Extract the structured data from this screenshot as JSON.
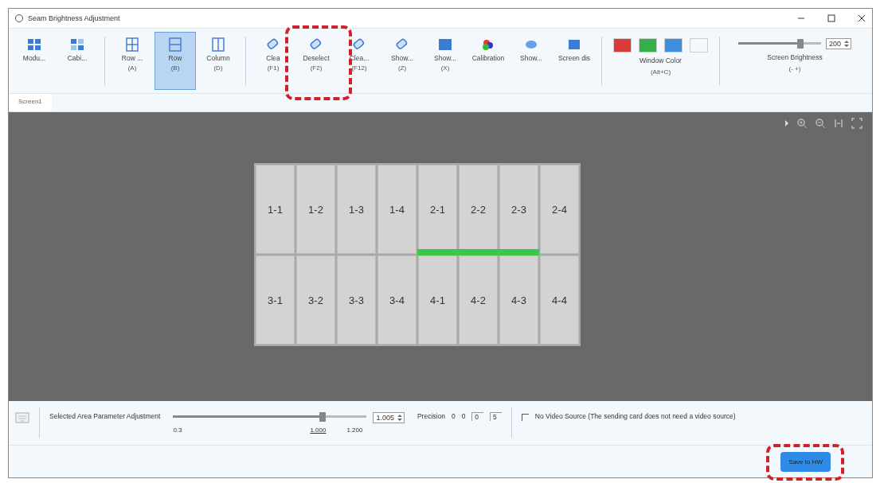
{
  "window": {
    "title": "Seam Brightness Adjustment"
  },
  "toolbar": {
    "groups": [
      {
        "items": [
          {
            "label": "Modu...",
            "selected": false
          },
          {
            "label": "Cabi...",
            "selected": false
          }
        ]
      },
      {
        "items": [
          {
            "label": "Row ...",
            "shortcut": "(A)",
            "selected": false
          },
          {
            "label": "Row",
            "shortcut": "(B)",
            "selected": true
          },
          {
            "label": "Column",
            "shortcut": "(D)",
            "selected": false
          }
        ]
      },
      {
        "items": [
          {
            "label": "Clea",
            "shortcut": "(F1)",
            "selected": false
          },
          {
            "label": "Deselect",
            "shortcut": "(F2)",
            "selected": false
          },
          {
            "label": "Clea...",
            "shortcut": "(F12)",
            "selected": false
          },
          {
            "label": "Show...",
            "shortcut": "(Z)",
            "selected": false
          },
          {
            "label": "Show...",
            "shortcut": "(X)",
            "selected": false
          },
          {
            "label": "Calibration",
            "selected": false
          },
          {
            "label": "Show...",
            "selected": false
          },
          {
            "label": "Screen dis",
            "selected": false
          }
        ]
      }
    ],
    "window_color": {
      "label": "Window Color",
      "shortcut": "(Alt+C)",
      "swatches": [
        {
          "color": "#d93a3a"
        },
        {
          "color": "#33b04a"
        },
        {
          "color": "#3d8fe0"
        },
        {
          "color": "#f4f8fc"
        }
      ]
    },
    "screen_brightness": {
      "label": "Screen Brightness",
      "shortcut": "(- +)",
      "level": 0.75,
      "value": "200"
    }
  },
  "tabs": [
    {
      "label": "Screen1",
      "selected": true
    }
  ],
  "grid": {
    "rows": [
      {
        "cells": [
          {
            "label": "1-1",
            "seam_selected": false
          },
          {
            "label": "1-2",
            "seam_selected": false
          },
          {
            "label": "1-3",
            "seam_selected": false
          },
          {
            "label": "1-4",
            "seam_selected": false
          },
          {
            "label": "2-1",
            "seam_selected": true
          },
          {
            "label": "2-2",
            "seam_selected": true
          },
          {
            "label": "2-3",
            "seam_selected": true
          },
          {
            "label": "2-4",
            "seam_selected": false
          }
        ]
      },
      {
        "cells": [
          {
            "label": "3-1",
            "seam_selected": false
          },
          {
            "label": "3-2",
            "seam_selected": false
          },
          {
            "label": "3-3",
            "seam_selected": false
          },
          {
            "label": "3-4",
            "seam_selected": false
          },
          {
            "label": "4-1",
            "seam_selected": false
          },
          {
            "label": "4-2",
            "seam_selected": false
          },
          {
            "label": "4-3",
            "seam_selected": false
          },
          {
            "label": "4-4",
            "seam_selected": false
          }
        ]
      }
    ]
  },
  "parameter": {
    "label": "Selected Area Parameter Adjustment",
    "level": 0.77,
    "ticks": [
      "0.3",
      "1.000",
      "1.200"
    ],
    "value": "1.005",
    "precision_label": "Precision",
    "precision_digits": [
      "0",
      "0"
    ],
    "precision_fields": [
      "0",
      "5"
    ]
  },
  "no_video_source": {
    "label": "No Video Source (The sending card does not need a video source)",
    "checked": false
  },
  "save_button": "Save to HW"
}
